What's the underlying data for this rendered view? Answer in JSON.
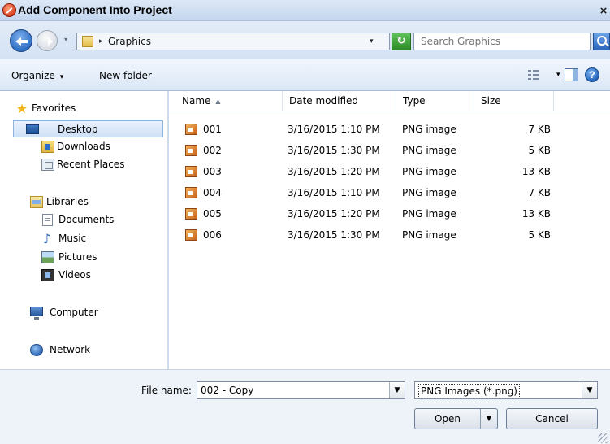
{
  "window": {
    "title": "Add Component Into Project",
    "close_glyph": "×"
  },
  "address_bar": {
    "crumb": "Graphics",
    "crumb_separator": "▸",
    "dropdown_glyph": "▾",
    "search_placeholder": "Search Graphics",
    "refresh_glyph": "↻"
  },
  "command_bar": {
    "organize_label": "Organize",
    "organize_arrow": "▾",
    "new_folder_label": "New folder",
    "view_arrow": "▾",
    "help_glyph": "?"
  },
  "nav": {
    "favorites": {
      "label": "Favorites",
      "icon": "star-icon"
    },
    "favorite_items": [
      {
        "label": "Desktop",
        "icon": "desktop-icon",
        "selected": true
      },
      {
        "label": "Downloads",
        "icon": "downloads-icon"
      },
      {
        "label": "Recent Places",
        "icon": "recent-places-icon"
      }
    ],
    "libraries": {
      "label": "Libraries",
      "icon": "libraries-icon"
    },
    "library_items": [
      {
        "label": "Documents",
        "icon": "documents-icon"
      },
      {
        "label": "Music",
        "icon": "music-icon",
        "glyph": "♪"
      },
      {
        "label": "Pictures",
        "icon": "pictures-icon"
      },
      {
        "label": "Videos",
        "icon": "videos-icon"
      }
    ],
    "computer": {
      "label": "Computer",
      "icon": "computer-icon"
    },
    "network": {
      "label": "Network",
      "icon": "network-icon"
    },
    "star_glyph": "★"
  },
  "file_list": {
    "columns": {
      "name": "Name",
      "date_modified": "Date modified",
      "type": "Type",
      "size": "Size",
      "sort_glyph": "▲"
    },
    "rows": [
      {
        "name": "001",
        "date": "3/16/2015 1:10 PM",
        "type": "PNG image",
        "size": "7 KB"
      },
      {
        "name": "002",
        "date": "3/16/2015 1:30 PM",
        "type": "PNG image",
        "size": "5 KB"
      },
      {
        "name": "003",
        "date": "3/16/2015 1:20 PM",
        "type": "PNG image",
        "size": "13 KB"
      },
      {
        "name": "004",
        "date": "3/16/2015 1:10 PM",
        "type": "PNG image",
        "size": "7 KB"
      },
      {
        "name": "005",
        "date": "3/16/2015 1:20 PM",
        "type": "PNG image",
        "size": "13 KB"
      },
      {
        "name": "006",
        "date": "3/16/2015 1:30 PM",
        "type": "PNG image",
        "size": "5 KB"
      }
    ]
  },
  "bottom": {
    "file_name_label": "File name:",
    "file_name_value": "002 - Copy",
    "file_type_value": "PNG Images (*.png)",
    "combo_glyph": "▼",
    "open_label": "Open",
    "cancel_label": "Cancel"
  }
}
